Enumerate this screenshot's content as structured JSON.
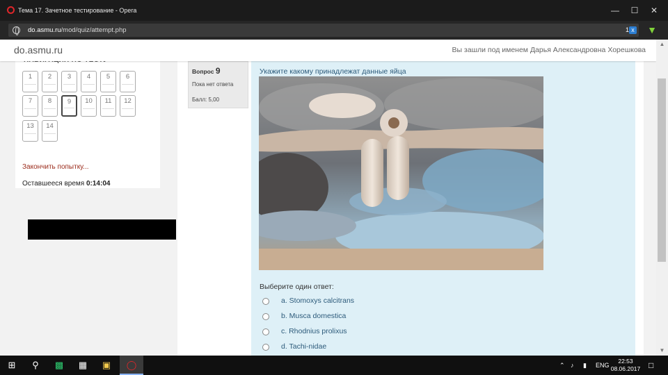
{
  "window": {
    "title": "Тема 17. Зачетное тестирование - Opera",
    "controls": [
      "minimize-icon",
      "maximize-icon",
      "close-icon"
    ]
  },
  "addressbar": {
    "url_domain": "do.asmu.ru",
    "url_path": "/mod/quiz/attempt.php",
    "counter": "1",
    "badge": "x"
  },
  "site": {
    "brand": "do.asmu.ru",
    "login_info": "Вы зашли под именем Дарья Александровна Хорешкова"
  },
  "navigation": {
    "title": "НАВИГАЦИЯ ПО ТЕСТУ",
    "buttons": [
      "1",
      "2",
      "3",
      "4",
      "5",
      "6",
      "7",
      "8",
      "9",
      "10",
      "11",
      "12",
      "13",
      "14"
    ],
    "current": "9",
    "finish_label": "Закончить попытку...",
    "timer_label": "Оставшееся время",
    "timer_value": "0:14:04"
  },
  "question": {
    "number_label": "Вопрос",
    "number": "9",
    "state": "Пока нет ответа",
    "grade": "Балл: 5,00",
    "text": "Укажите какому принадлежат данные яйца",
    "prompt": "Выберите один ответ:",
    "answers": [
      "a. Stomoxys calcitrans",
      "b. Musca domestica",
      "c. Rhodnius prolixus",
      "d. Tachi-nidae"
    ]
  },
  "taskbar": {
    "language": "ENG",
    "time": "22:53",
    "date": "08.06.2017"
  },
  "colors": {
    "formulation_bg": "#def0f7",
    "link": "#9a2a1a",
    "opera_red": "#e0262a"
  }
}
